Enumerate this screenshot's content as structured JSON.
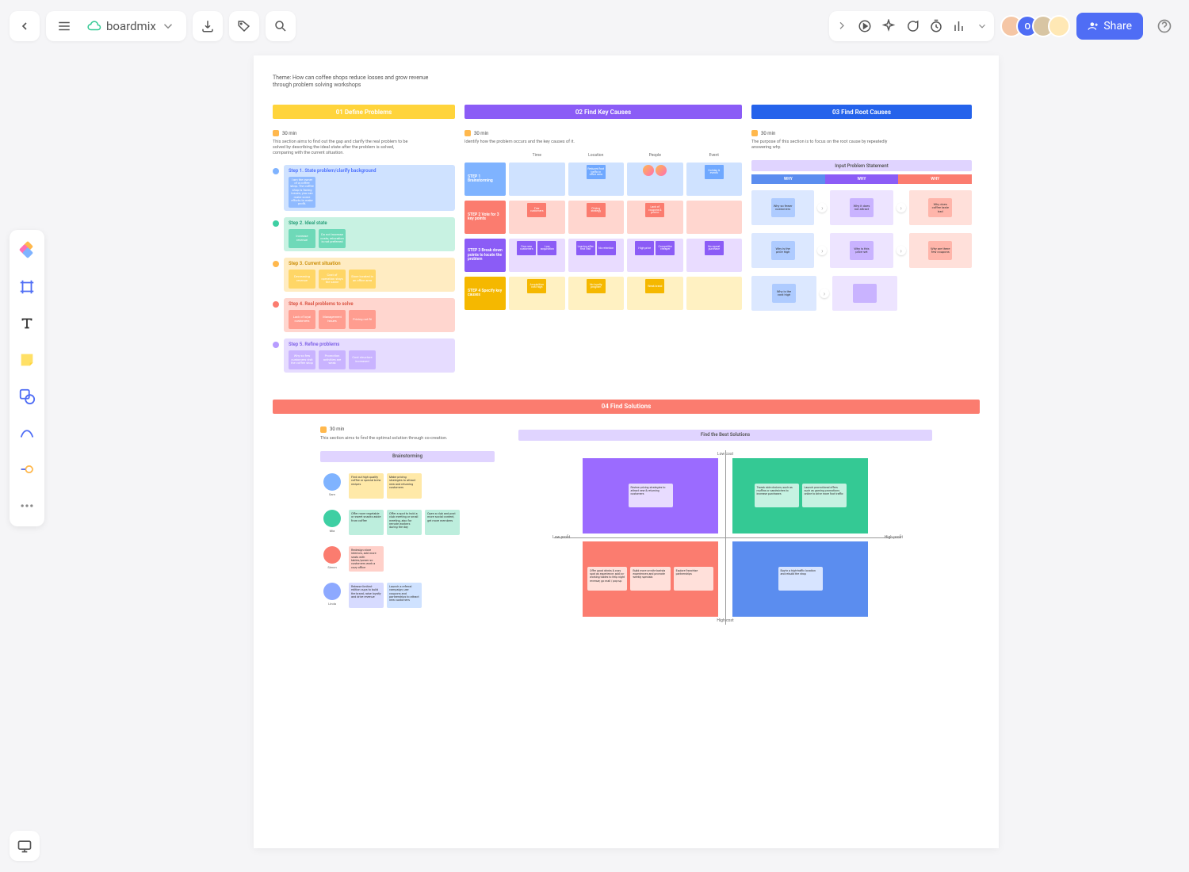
{
  "app": {
    "title": "boardmix"
  },
  "topbar": {
    "share": "Share"
  },
  "avatars": [
    "O"
  ],
  "canvas": {
    "theme": "Theme: How can coffee shops reduce losses and grow revenue through problem solving workshops",
    "s1": {
      "title": "01 Define Problems",
      "timer": "30 min",
      "desc": "This section aims to find out the gap and clarify the real problem to be solved by describing the ideal state after the problem is solved, comparing with the current situation.",
      "steps": [
        {
          "label": "Step 1. State problem/clarify background",
          "notes": [
            "I am the owner of a coffee shop. The coffee shop is facing losses, you can make some efforts to make profit."
          ]
        },
        {
          "label": "Step 2. Ideal state",
          "notes": [
            "Increase revenue",
            "Do not increase costs; relocation is not preferred"
          ]
        },
        {
          "label": "Step 3. Current situation",
          "notes": [
            "Decreasing revenue",
            "Cost of operation stays the same",
            "Store located in an office area"
          ]
        },
        {
          "label": "Step 4. Real problems to solve",
          "notes": [
            "Lack of loyal customers",
            "Management issues",
            "Pricing not fit"
          ]
        },
        {
          "label": "Step 5. Refine problems",
          "notes": [
            "Why so few customers visit the coffee shop",
            "Promotion activities are weak",
            "Cost structure increased"
          ]
        }
      ]
    },
    "s2": {
      "title": "02 Find Key Causes",
      "timer": "30 min",
      "desc": "Identify how the problem occurs and the key causes of it.",
      "cols": [
        "Time",
        "Location",
        "People",
        "Event"
      ],
      "rows": [
        {
          "label": "STEP 1 Brainstorming",
          "bg": "#7fb3ff",
          "cells": [
            {
              "bg": "#cfe2ff",
              "notes": []
            },
            {
              "bg": "#cfe2ff",
              "notes": [
                {
                  "t": "Reduced foot traffic in office area",
                  "c": "#6fa8ff"
                }
              ]
            },
            {
              "bg": "#cfe2ff",
              "notes": [
                {
                  "t": "avatar",
                  "c": "avatar"
                },
                {
                  "t": "avatar",
                  "c": "avatar"
                }
              ]
            },
            {
              "bg": "#cfe2ff",
              "notes": [
                {
                  "t": "Holiday & events",
                  "c": "#6fa8ff"
                }
              ]
            }
          ]
        },
        {
          "label": "STEP 2 Vote for 3 key points",
          "bg": "#fb7c6f",
          "cells": [
            {
              "bg": "#ffd6cf",
              "notes": [
                {
                  "t": "Few customers",
                  "c": "#fb7c6f"
                }
              ]
            },
            {
              "bg": "#ffd6cf",
              "notes": [
                {
                  "t": "Pricing strategy",
                  "c": "#fb7c6f"
                }
              ]
            },
            {
              "bg": "#ffd6cf",
              "notes": [
                {
                  "t": "Lack of coupons & promo",
                  "c": "#fb7c6f"
                }
              ]
            },
            {
              "bg": "#ffd6cf",
              "notes": []
            }
          ]
        },
        {
          "label": "STEP 3 Break down points to locate the problem",
          "bg": "#8b5cf6",
          "cells": [
            {
              "bg": "#e9dcff",
              "notes": [
                {
                  "t": "Few new customers",
                  "c": "#8b5cf6"
                },
                {
                  "t": "Low acquisition",
                  "c": "#8b5cf6"
                }
              ]
            },
            {
              "bg": "#e9dcff",
              "notes": [
                {
                  "t": "Leaving after first visit",
                  "c": "#8b5cf6"
                },
                {
                  "t": "No retention",
                  "c": "#8b5cf6"
                }
              ]
            },
            {
              "bg": "#e9dcff",
              "notes": [
                {
                  "t": "High price",
                  "c": "#8b5cf6"
                },
                {
                  "t": "Competitor cheaper",
                  "c": "#8b5cf6"
                }
              ]
            },
            {
              "bg": "#e9dcff",
              "notes": [
                {
                  "t": "No repeat purchase",
                  "c": "#8b5cf6"
                }
              ]
            }
          ]
        },
        {
          "label": "STEP 4 Specify key causes",
          "bg": "#f5b800",
          "cells": [
            {
              "bg": "#fff1c2",
              "notes": [
                {
                  "t": "Acquisition cost high",
                  "c": "#f5b800"
                }
              ]
            },
            {
              "bg": "#fff1c2",
              "notes": [
                {
                  "t": "No loyalty program",
                  "c": "#f5b800"
                }
              ]
            },
            {
              "bg": "#fff1c2",
              "notes": [
                {
                  "t": "Weak brand",
                  "c": "#f5b800"
                }
              ]
            },
            {
              "bg": "#fff1c2",
              "notes": []
            }
          ]
        }
      ]
    },
    "s3": {
      "title": "03 Find Root Causes",
      "timer": "30 min",
      "desc": "The purpose of this section is to focus on the root cause by repeatedly answering why.",
      "banner": "Input Problem Statement",
      "why": [
        "WHY",
        "WHY",
        "WHY"
      ],
      "chains": [
        [
          {
            "t": "Why so fewer customers",
            "c": "#aecbff"
          },
          {
            "t": "Why it does not attract",
            "c": "#c9b3ff"
          },
          {
            "t": "Why does coffee taste bad",
            "c": "#ffb5aa"
          }
        ],
        [
          {
            "t": "Why is the price high",
            "c": "#aecbff"
          },
          {
            "t": "Why is this price set",
            "c": "#c9b3ff"
          },
          {
            "t": "Why are there few coupons",
            "c": "#ffb5aa"
          }
        ],
        [
          {
            "t": "Why is the cost high",
            "c": "#aecbff"
          },
          {
            "t": "",
            "c": "#c9b3ff"
          },
          {
            "t": "",
            "c": ""
          }
        ]
      ]
    },
    "s4": {
      "title": "04 Find Solutions",
      "timer": "30 min",
      "desc": "This section aims to find the optimal solution through co-creation.",
      "left_head": "Brainstorming",
      "right_head": "Find the Best Solutions",
      "people": [
        {
          "name": "Sam",
          "color": "#7fb3ff",
          "notes": [
            {
              "t": "Find out high quality coffee or special brew recipes",
              "c": "#ffe9a8"
            },
            {
              "t": "Make pricing strategies to attract new and returning customers",
              "c": "#ffe9a8"
            }
          ]
        },
        {
          "name": "Mia",
          "color": "#3ecfa3",
          "notes": [
            {
              "t": "Offer more vegetable or sweet snacks aside from coffee",
              "c": "#bdeedd"
            },
            {
              "t": "Offer a spot to hold a club meeting or small meeting, also for remote workers during the day",
              "c": "#bdeedd"
            },
            {
              "t": "Open a club and post more social content, get more members",
              "c": "#bdeedd"
            }
          ]
        },
        {
          "name": "Simon",
          "color": "#fb7c6f",
          "notes": [
            {
              "t": "Redesign store interiors, add more seats with tables/power so customers work a cozy office",
              "c": "#ffd0c9"
            }
          ]
        },
        {
          "name": "Linda",
          "color": "#8da9ff",
          "notes": [
            {
              "t": "Release limited-edition cups to build the brand, raise loyalty and drive revenue",
              "c": "#d7dbff"
            },
            {
              "t": "Launch a referral campaign; use coupons and partnerships to attract new customers",
              "c": "#cfe2ff"
            }
          ]
        }
      ],
      "axes": {
        "top": "Low cost",
        "bottom": "High cost",
        "left": "Low profit",
        "right": "High profit"
      },
      "quads": [
        {
          "bg": "#9b6bff",
          "notes": [
            {
              "t": "Review pricing strategies to attract new & returning customers",
              "c": "#e8dcff"
            }
          ]
        },
        {
          "bg": "#34c994",
          "notes": [
            {
              "t": "Tweak side choices, such as muffins or sandwiches to increase purchases",
              "c": "#c6f2e2"
            },
            {
              "t": "Launch promotional offers such as gaming promotions online to drive more foot traffic",
              "c": "#c6f2e2"
            }
          ]
        },
        {
          "bg": "#fb7c6f",
          "notes": [
            {
              "t": "Offer good drinks & cozy spot as experience; add co-working tables to help night revenue; go mall / pop-up",
              "c": "#ffe0da"
            },
            {
              "t": "Build more on-site barista experiences and promote weekly specials",
              "c": "#ffe0da"
            },
            {
              "t": "Explore franchise partnerships",
              "c": "#ffe0da"
            }
          ]
        },
        {
          "bg": "#5b8def",
          "notes": [
            {
              "t": "Buy-in a high-traffic location and rebuild the shop",
              "c": "#d7e4ff"
            }
          ]
        }
      ]
    }
  }
}
